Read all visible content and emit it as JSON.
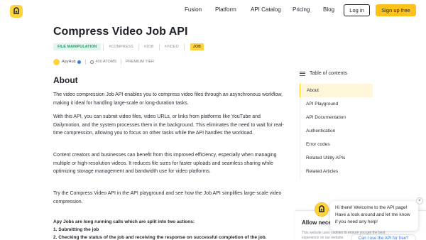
{
  "header": {
    "nav": [
      "Fusion",
      "Platform",
      "API Catalog",
      "Pricing",
      "Blog"
    ],
    "login_label": "Log in",
    "signup_label": "Sign up free",
    "accent_color": "#ffc21a"
  },
  "page": {
    "title": "Compress Video Job API",
    "category": "FILE MANIPULATION",
    "tags": [
      "#COMPRESS",
      "#JOB",
      "#VIDEO"
    ],
    "job_badge": "JOB",
    "publisher": "ApyHub",
    "atoms": "400 ATOMS",
    "tier": "PREMIUM TIER"
  },
  "content": {
    "heading": "About",
    "paragraphs": [
      "The video compression Job API enables you to compress video files through an asynchronous workflow, making it ideal for handling large-scale or long-duration tasks.",
      "With this API, you can submit video files, video URLs, or links from platforms like YouTube and Dailymotion, and the system processes them in the background. This eliminates the need to wait for real-time compression, allowing you to focus on other tasks while the API handles the workload.",
      "Content creators and businesses can benefit from this improved efficiency, especially when managing multiple or high-resolution videos. It reduces file sizes for faster uploads and seamless sharing while optimizing storage management and bandwidth use for video platforms.",
      "Try the Compress Video API in the API playground and see how the Job API simplifies large-scale video compression."
    ],
    "bold_lines": [
      "Apy Jobs are long running calls which are split into two actions:",
      "1. Submitting the job",
      "2. Checking the status of the job and receiving the response on successful completion of the job."
    ]
  },
  "toc": {
    "heading": "Table of contents",
    "items": [
      "About",
      "API Playground",
      "API Documentation",
      "Authentication",
      "Error codes",
      "Related Utility APIs",
      "Related Articles"
    ]
  },
  "cookie": {
    "title": "Allow neces",
    "text": "This website uses cookies to ensure you get the best experience on our website."
  },
  "chat": {
    "message": "Hi there! Welcome to the API page! Have a look around and let me know if you need any help!",
    "cta": "Can I use the API for free?",
    "close": "×"
  }
}
